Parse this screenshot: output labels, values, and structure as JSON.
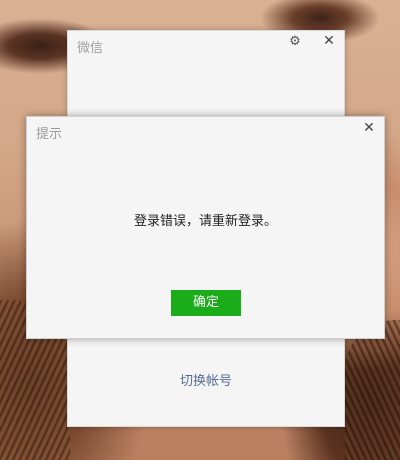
{
  "main_window": {
    "title": "微信",
    "settings_icon": "gear-icon",
    "close_icon": "close-icon",
    "close_glyph": "✕",
    "settings_glyph": "⚙",
    "switch_account_label": "切换帐号"
  },
  "dialog": {
    "title": "提示",
    "close_glyph": "✕",
    "message": "登录错误，请重新登录。",
    "ok_label": "确定"
  },
  "colors": {
    "accent_green": "#1aad19",
    "link_blue": "#576b95",
    "window_bg": "#f5f5f5"
  }
}
